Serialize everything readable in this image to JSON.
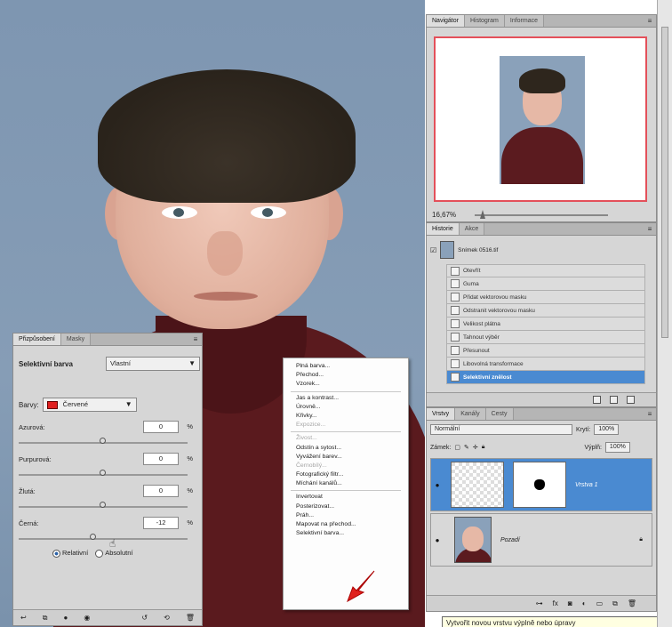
{
  "navigator": {
    "tabs": [
      "Navigátor",
      "Histogram",
      "Informace"
    ],
    "zoom": "16,67%"
  },
  "history": {
    "tabs": [
      "Historie",
      "Akce"
    ],
    "snapshot": "Snímek 0516.tif",
    "items": [
      {
        "label": "Otevřít",
        "active": false
      },
      {
        "label": "Guma",
        "active": false
      },
      {
        "label": "Přidat vektorovou masku",
        "active": false
      },
      {
        "label": "Odstranit vektorovou masku",
        "active": false
      },
      {
        "label": "Velikost plátna",
        "active": false
      },
      {
        "label": "Tahnout výběr",
        "active": false
      },
      {
        "label": "Přesunout",
        "active": false
      },
      {
        "label": "Libovolná transformace",
        "active": false
      },
      {
        "label": "Selektivní znělost",
        "active": true
      }
    ]
  },
  "layers": {
    "tabs": [
      "Vrstvy",
      "Kanály",
      "Cesty"
    ],
    "blend_mode": "Normální",
    "opacity_label": "Krytí:",
    "opacity": "100%",
    "lock_label": "Zámek:",
    "fill_label": "Výplň:",
    "fill": "100%",
    "items": [
      {
        "name": "Vrstva 1",
        "active": true
      },
      {
        "name": "Pozadí",
        "active": false
      }
    ]
  },
  "adjustments": {
    "tabs": [
      "Přizpůsobení",
      "Masky"
    ],
    "title": "Selektivní barva",
    "preset": "Vlastní",
    "colors_label": "Barvy:",
    "colors_value": "Červené",
    "sliders": [
      {
        "label": "Azurová:",
        "value": "0",
        "unit": "%",
        "level": 0.5
      },
      {
        "label": "Purpurová:",
        "value": "0",
        "unit": "%",
        "level": 0.5
      },
      {
        "label": "Žlutá:",
        "value": "0",
        "unit": "%",
        "level": 0.5
      },
      {
        "label": "Černá:",
        "value": "-12",
        "unit": "%",
        "level": 0.44
      }
    ],
    "radio_relative": "Relativní",
    "radio_absolute": "Absolutní"
  },
  "context_menu": {
    "groups": [
      [
        {
          "label": "Plná barva...",
          "disabled": false
        },
        {
          "label": "Přechod...",
          "disabled": false
        },
        {
          "label": "Vzorek...",
          "disabled": false
        }
      ],
      [
        {
          "label": "Jas a kontrast...",
          "disabled": false
        },
        {
          "label": "Úrovně...",
          "disabled": false
        },
        {
          "label": "Křivky...",
          "disabled": false
        },
        {
          "label": "Expozice...",
          "disabled": true
        }
      ],
      [
        {
          "label": "Živost...",
          "disabled": true
        },
        {
          "label": "Odstín a sytost...",
          "disabled": false
        },
        {
          "label": "Vyvážení barev...",
          "disabled": false
        },
        {
          "label": "Černobílý...",
          "disabled": true
        },
        {
          "label": "Fotografický filtr...",
          "disabled": false
        },
        {
          "label": "Míchání kanálů...",
          "disabled": false
        }
      ],
      [
        {
          "label": "Invertovat",
          "disabled": false
        },
        {
          "label": "Posterizovat...",
          "disabled": false
        },
        {
          "label": "Práh...",
          "disabled": false
        },
        {
          "label": "Mapovat na přechod...",
          "disabled": false
        },
        {
          "label": "Selektivní barva...",
          "disabled": false
        }
      ]
    ]
  },
  "tooltip": "Vytvořit novou vrstvu výplně nebo úpravy",
  "colors": {
    "accent": "#4a8ad1",
    "selection_red": "#e02020"
  }
}
